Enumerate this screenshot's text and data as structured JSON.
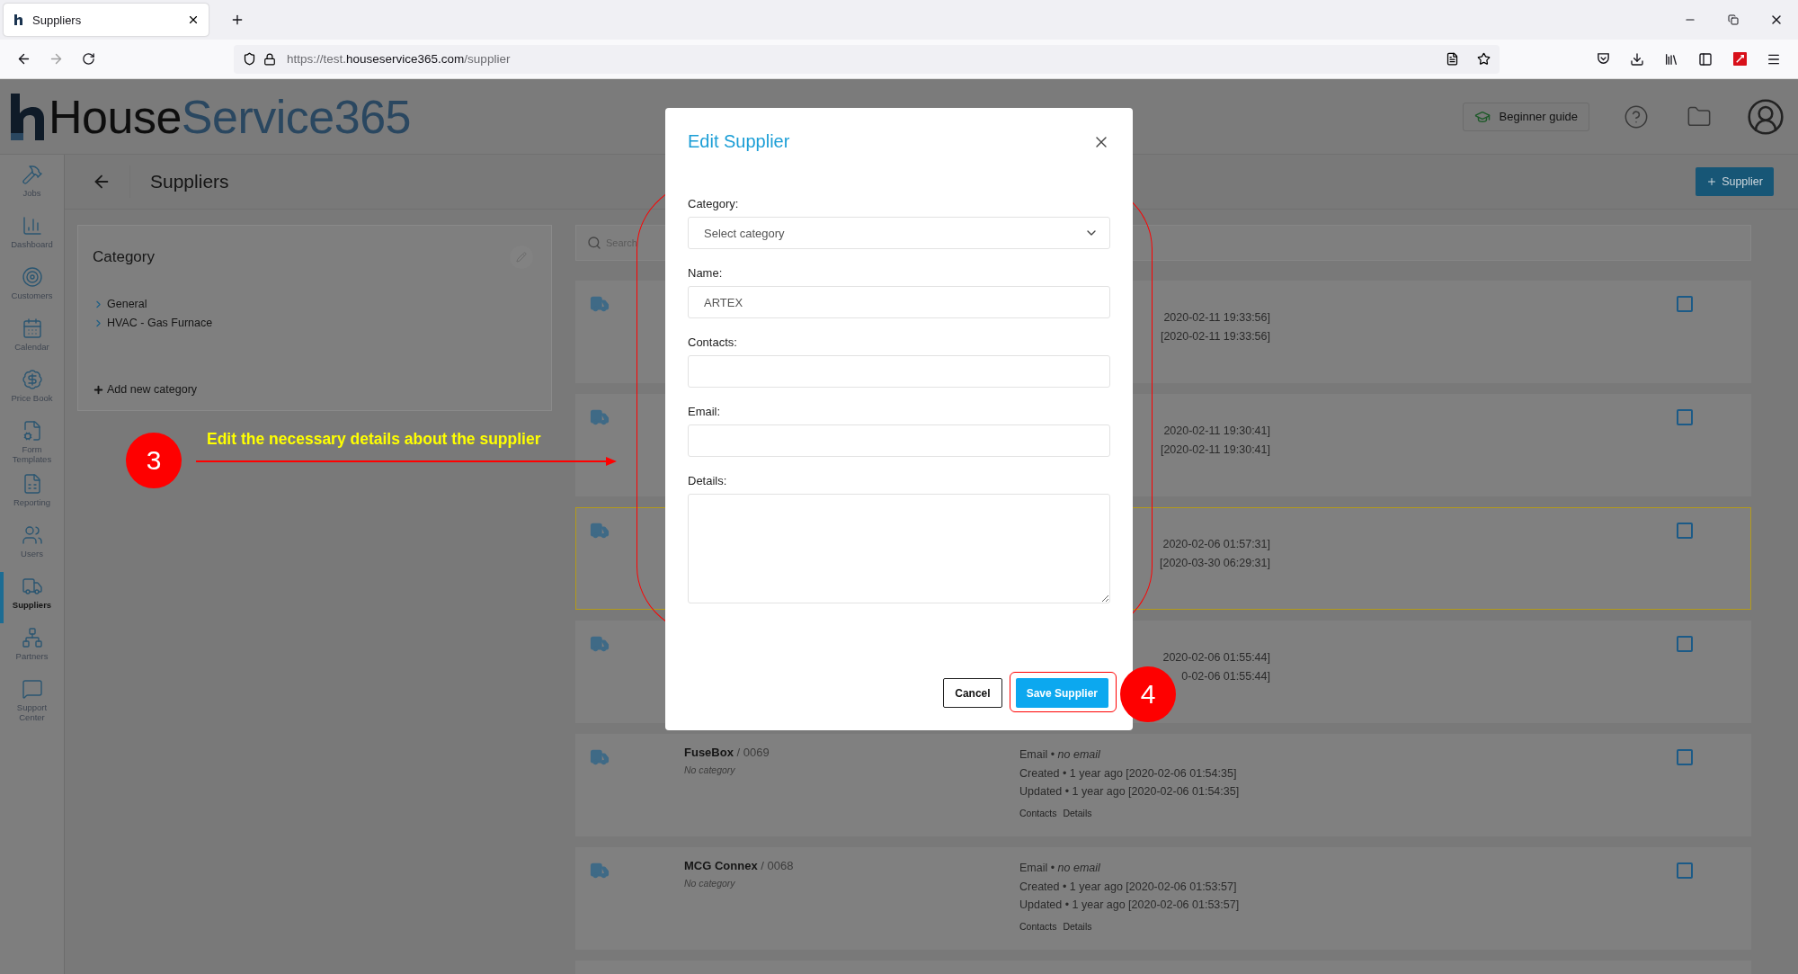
{
  "browser": {
    "tab_title": "Suppliers",
    "url": "https://test.**houseservice365.com**/supplier"
  },
  "app_header": {
    "logo": {
      "part1": "House",
      "part2": "Service365"
    },
    "guide_button": "Beginner guide"
  },
  "sidebar": {
    "items": [
      {
        "label": "Jobs",
        "selected": false
      },
      {
        "label": "Dashboard",
        "selected": false
      },
      {
        "label": "Customers",
        "selected": false
      },
      {
        "label": "Calendar",
        "selected": false
      },
      {
        "label": "Price Book",
        "selected": false
      },
      {
        "label": "Form Templates",
        "selected": false
      },
      {
        "label": "Reporting",
        "selected": false
      },
      {
        "label": "Users",
        "selected": false
      },
      {
        "label": "Suppliers",
        "selected": true
      },
      {
        "label": "Partners",
        "selected": false
      },
      {
        "label": "Support Center",
        "selected": false
      }
    ]
  },
  "page": {
    "title": "Suppliers",
    "add_button": "Supplier"
  },
  "category_panel": {
    "title": "Category",
    "items": [
      {
        "label": "General",
        "expanded": false
      },
      {
        "label": "HVAC - Gas Furnace",
        "expanded": false
      }
    ],
    "add_link": "Add new category"
  },
  "search": {
    "placeholder": "Search"
  },
  "suppliers": [
    {
      "kind": "covered",
      "highlighted": false,
      "checked": false,
      "lines": [
        "2020-02-11 19:33:56]",
        "[2020-02-11 19:33:56]"
      ]
    },
    {
      "kind": "covered",
      "highlighted": false,
      "checked": false,
      "lines": [
        "2020-02-11 19:30:41]",
        "[2020-02-11 19:30:41]"
      ]
    },
    {
      "kind": "covered",
      "highlighted": true,
      "checked": false,
      "lines": [
        "2020-02-06 01:57:31]",
        "[2020-03-30 06:29:31]"
      ]
    },
    {
      "kind": "covered",
      "highlighted": false,
      "checked": false,
      "lines": [
        "2020-02-06 01:55:44]",
        "0-02-06 01:55:44]"
      ]
    },
    {
      "kind": "full",
      "highlighted": false,
      "checked": false,
      "name": "FuseBox",
      "number": "/ 0069",
      "category": "No category",
      "email": "Email • *no email*",
      "created": "Created • 1 year ago [2020-02-06 01:54:35]",
      "updated": "Updated • 1 year ago [2020-02-06 01:54:35]",
      "links": [
        "Contacts",
        "Details"
      ]
    },
    {
      "kind": "full",
      "highlighted": false,
      "checked": false,
      "name": "MCG Connex",
      "number": "/ 0068",
      "category": "No category",
      "email": "Email • *no email*",
      "created": "Created • 1 year ago [2020-02-06 01:53:57]",
      "updated": "Updated • 1 year ago [2020-02-06 01:53:57]",
      "links": [
        "Contacts",
        "Details"
      ]
    },
    {
      "kind": "cut",
      "highlighted": false
    }
  ],
  "modal": {
    "title": "Edit Supplier",
    "fields": [
      {
        "kind": "select",
        "label": "Category:",
        "placeholder": "Select category"
      },
      {
        "kind": "text",
        "label": "Name:",
        "value": "ARTEX"
      },
      {
        "kind": "text",
        "label": "Contacts:"
      },
      {
        "kind": "text",
        "label": "Email:"
      },
      {
        "kind": "textarea",
        "label": "Details:"
      }
    ],
    "buttons": [
      {
        "kind": "secondary",
        "label": "Cancel"
      },
      {
        "kind": "primary",
        "label": "Save Supplier"
      }
    ]
  },
  "callouts": [
    {
      "number": "3",
      "text": "Edit the necessary details about the supplier"
    },
    {
      "number": "4"
    }
  ]
}
